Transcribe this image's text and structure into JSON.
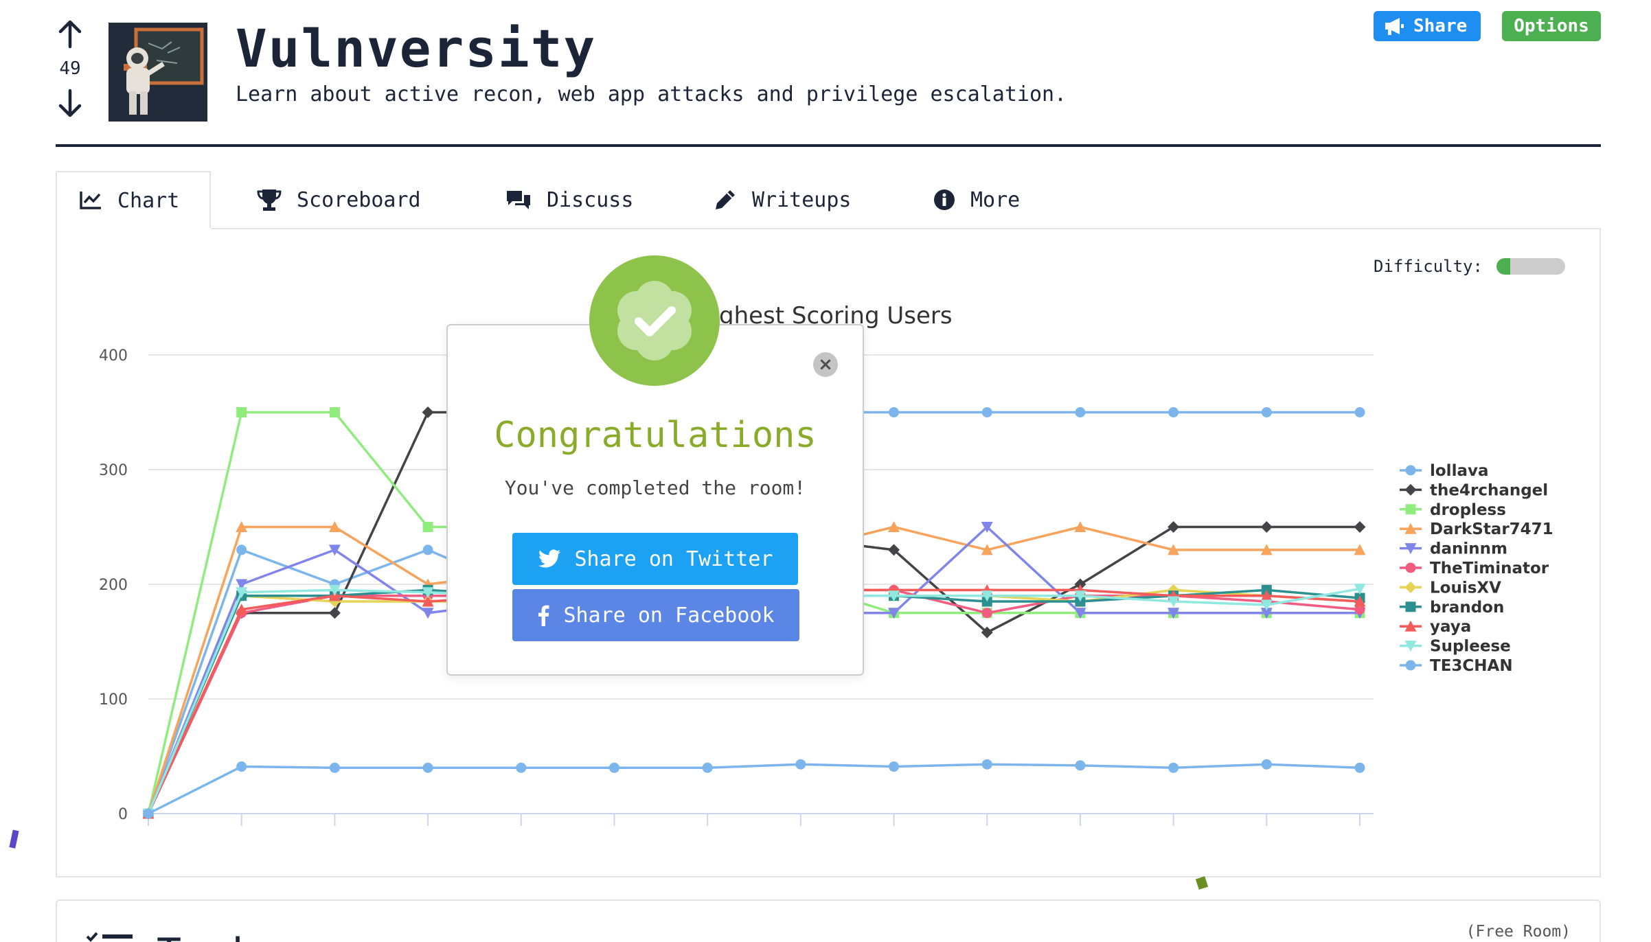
{
  "room": {
    "votes": "49",
    "title": "Vulnversity",
    "description": "Learn about active recon, web app attacks and privilege escalation."
  },
  "header_buttons": {
    "share_label": "Share",
    "options_label": "Options"
  },
  "tabs": [
    {
      "label": "Chart",
      "icon": "chart-line-icon",
      "active": true
    },
    {
      "label": "Scoreboard",
      "icon": "trophy-icon"
    },
    {
      "label": "Discuss",
      "icon": "comments-icon"
    },
    {
      "label": "Writeups",
      "icon": "pen-icon"
    },
    {
      "label": "More",
      "icon": "info-circle-icon"
    }
  ],
  "difficulty": {
    "label": "Difficulty:",
    "level_fraction": 0.2,
    "color": "#4caf50"
  },
  "chart_data": {
    "type": "line",
    "title": "ghest Scoring Users",
    "ylim": [
      0,
      400
    ],
    "yticks": [
      0,
      100,
      200,
      300,
      400
    ],
    "x": [
      0,
      1,
      2,
      3,
      4,
      5,
      6,
      7,
      8,
      9,
      10,
      11,
      12,
      13
    ],
    "legend_position": "right",
    "series": [
      {
        "name": "lollava",
        "color": "#7cb5ec",
        "marker": "circle",
        "values": [
          0,
          230,
          200,
          230,
          195,
          195,
          350,
          350,
          350,
          350,
          350,
          350,
          350,
          350
        ]
      },
      {
        "name": "the4rchangel",
        "color": "#434348",
        "marker": "diamond",
        "values": [
          0,
          175,
          175,
          350,
          350,
          350,
          240,
          240,
          230,
          158,
          200,
          250,
          250,
          250
        ]
      },
      {
        "name": "dropless",
        "color": "#90ed7d",
        "marker": "square",
        "values": [
          0,
          350,
          350,
          250,
          250,
          230,
          200,
          200,
          175,
          175,
          175,
          175,
          175,
          175
        ]
      },
      {
        "name": "DarkStar7471",
        "color": "#f7a35c",
        "marker": "triangle",
        "values": [
          0,
          250,
          250,
          200,
          210,
          220,
          230,
          230,
          250,
          230,
          250,
          230,
          230,
          230
        ]
      },
      {
        "name": "daninnm",
        "color": "#8085e9",
        "marker": "triangle-down",
        "values": [
          0,
          200,
          230,
          175,
          185,
          190,
          185,
          175,
          175,
          250,
          175,
          175,
          175,
          175
        ]
      },
      {
        "name": "TheTiminator",
        "color": "#f15c80",
        "marker": "circle",
        "values": [
          0,
          175,
          190,
          190,
          190,
          195,
          195,
          195,
          195,
          175,
          190,
          190,
          185,
          178
        ]
      },
      {
        "name": "LouisXV",
        "color": "#e4d354",
        "marker": "diamond",
        "values": [
          0,
          190,
          185,
          185,
          185,
          190,
          190,
          190,
          190,
          190,
          185,
          195,
          190,
          185
        ]
      },
      {
        "name": "brandon",
        "color": "#2b908f",
        "marker": "square",
        "values": [
          0,
          190,
          190,
          195,
          190,
          190,
          190,
          190,
          190,
          185,
          185,
          190,
          195,
          188
        ]
      },
      {
        "name": "yaya",
        "color": "#f45b5b",
        "marker": "triangle",
        "values": [
          0,
          178,
          190,
          185,
          190,
          195,
          195,
          195,
          195,
          195,
          195,
          190,
          190,
          185
        ]
      },
      {
        "name": "Supleese",
        "color": "#91e8e1",
        "marker": "triangle-down",
        "values": [
          0,
          193,
          195,
          193,
          190,
          190,
          190,
          190,
          190,
          190,
          190,
          185,
          182,
          196
        ]
      },
      {
        "name": "TE3CHAN",
        "color": "#7cb5ec",
        "marker": "circle",
        "values": [
          0,
          41,
          40,
          40,
          40,
          40,
          40,
          43,
          41,
          43,
          42,
          40,
          43,
          40
        ]
      }
    ]
  },
  "modal": {
    "title": "Congratulations",
    "subtitle": "You've completed the room!",
    "twitter_label": "Share on Twitter",
    "facebook_label": "Share on Facebook",
    "close_glyph": "×"
  },
  "tasks": {
    "title": "Tasks",
    "free_room_label": "(Free Room)"
  }
}
